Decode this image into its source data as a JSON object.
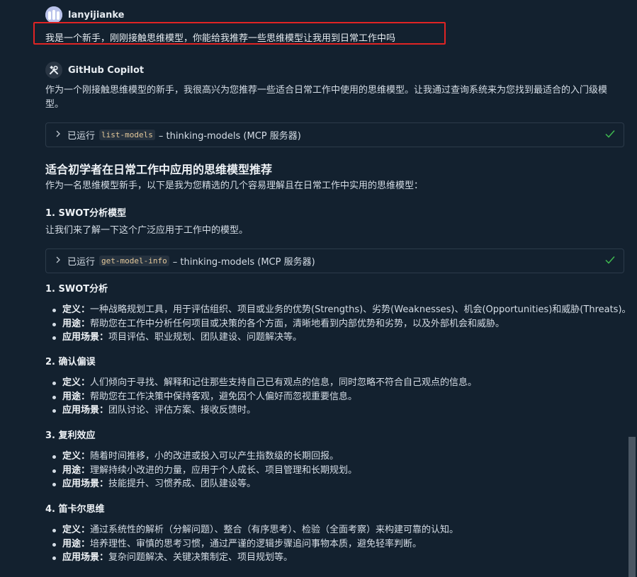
{
  "user": {
    "name": "lanyijianke",
    "message": "我是一个新手，刚刚接触思维模型，你能给我推荐一些思维模型让我用到日常工作中吗"
  },
  "assistant": {
    "name": "GitHub Copilot",
    "intro_line1": "作为一个刚接触思维模型的新手，我很高兴为您推荐一些适合日常工作中使用的思维模型。让我通过查询系统来为您找到最适合的入门级模",
    "intro_line2": "型。"
  },
  "tool1": {
    "prefix": "已运行",
    "code": "list-models",
    "suffix": "– thinking-models (MCP 服务器)"
  },
  "tool2": {
    "prefix": "已运行",
    "code": "get-model-info",
    "suffix": "– thinking-models (MCP 服务器)"
  },
  "heading": "适合初学者在日常工作中应用的思维模型推荐",
  "subintro": "作为一名思维模型新手，以下是我为您精选的几个容易理解且在日常工作中实用的思维模型：",
  "section1": {
    "title": "1. SWOT分析模型",
    "text": "让我们来了解一下这个广泛应用于工作中的模型。"
  },
  "labels": {
    "definition": "定义",
    "usage": "用途",
    "scenario": "应用场景",
    "sep": "："
  },
  "models": [
    {
      "title": "1. SWOT分析",
      "definition": "一种战略规划工具，用于评估组织、项目或业务的优势(Strengths)、劣势(Weaknesses)、机会(Opportunities)和威胁(Threats)。",
      "usage": "帮助您在工作中分析任何项目或决策的各个方面，清晰地看到内部优势和劣势，以及外部机会和威胁。",
      "scenario": "项目评估、职业规划、团队建设、问题解决等。"
    },
    {
      "title": "2. 确认偏误",
      "definition": "人们倾向于寻找、解释和记住那些支持自己已有观点的信息，同时忽略不符合自己观点的信息。",
      "usage": "帮助您在工作决策中保持客观，避免因个人偏好而忽视重要信息。",
      "scenario": "团队讨论、评估方案、接收反馈时。"
    },
    {
      "title": "3. 复利效应",
      "definition": "随着时间推移，小的改进或投入可以产生指数级的长期回报。",
      "usage": "理解持续小改进的力量，应用于个人成长、项目管理和长期规划。",
      "scenario": "技能提升、习惯养成、团队建设等。"
    },
    {
      "title": "4. 笛卡尔思维",
      "definition": "通过系统性的解析（分解问题）、整合（有序思考）、检验（全面考察）来构建可靠的认知。",
      "usage": "培养理性、审慎的思考习惯，通过严谨的逻辑步骤追问事物本质，避免轻率判断。",
      "scenario": "复杂问题解决、关键决策制定、项目规划等。"
    }
  ],
  "colors": {
    "background": "#13212f",
    "highlight_box": "#e02424",
    "check": "#3fb950",
    "code_text": "#e3c89a"
  }
}
